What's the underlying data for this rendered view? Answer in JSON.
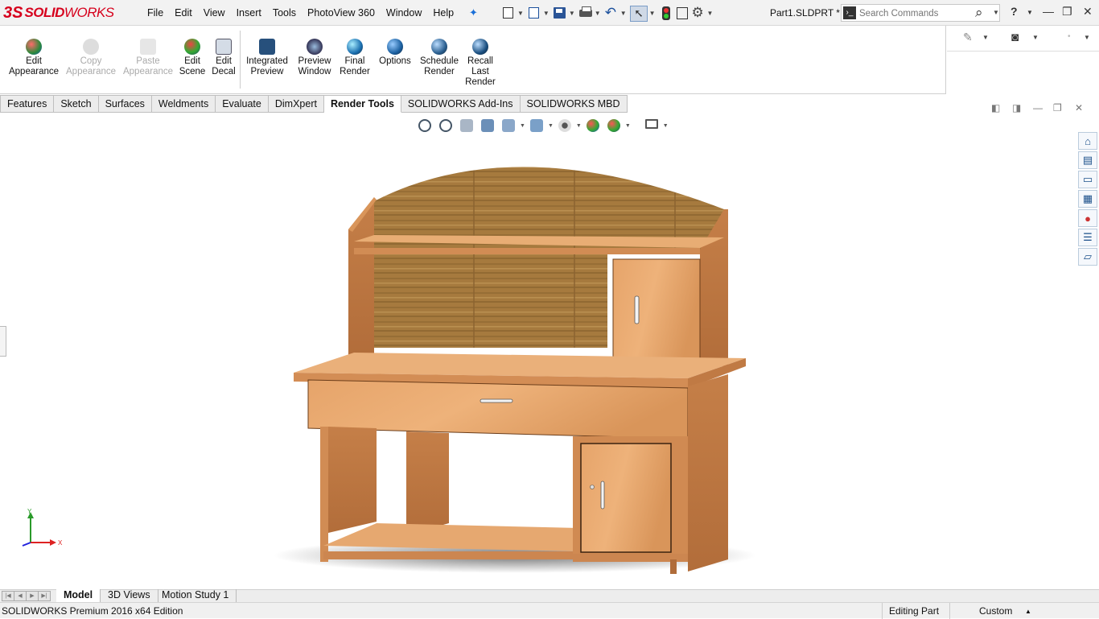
{
  "app": {
    "logo_mark": "3S",
    "logo_word_bold": "SOLID",
    "logo_word_rest": "WORKS",
    "filename": "Part1.SLDPRT *"
  },
  "menu": [
    "File",
    "Edit",
    "View",
    "Insert",
    "Tools",
    "PhotoView 360",
    "Window",
    "Help"
  ],
  "search": {
    "placeholder": "Search Commands"
  },
  "help": {
    "label": "?"
  },
  "commands": [
    {
      "label": "Edit\nAppearance",
      "enabled": true
    },
    {
      "label": "Copy\nAppearance",
      "enabled": false
    },
    {
      "label": "Paste\nAppearance",
      "enabled": false
    },
    {
      "label": "Edit\nScene",
      "enabled": true
    },
    {
      "label": "Edit\nDecal",
      "enabled": true
    },
    {
      "label": "Integrated\nPreview",
      "enabled": true
    },
    {
      "label": "Preview\nWindow",
      "enabled": true
    },
    {
      "label": "Final\nRender",
      "enabled": true
    },
    {
      "label": "Options",
      "enabled": true
    },
    {
      "label": "Schedule\nRender",
      "enabled": true
    },
    {
      "label": "Recall\nLast\nRender",
      "enabled": true
    }
  ],
  "tabs": [
    "Features",
    "Sketch",
    "Surfaces",
    "Weldments",
    "Evaluate",
    "DimXpert",
    "Render Tools",
    "SOLIDWORKS Add-Ins",
    "SOLIDWORKS MBD"
  ],
  "active_tab": "Render Tools",
  "triad": {
    "y": "Y",
    "x": "X"
  },
  "bottom_tabs": [
    "Model",
    "3D Views",
    "Motion Study 1"
  ],
  "active_bottom_tab": "Model",
  "status": {
    "edition": "SOLIDWORKS Premium 2016 x64 Edition",
    "mode": "Editing Part",
    "units": "Custom"
  },
  "colors": {
    "brand": "#d6001c",
    "wood_light": "#e8a46c",
    "wood_dark": "#c47a44",
    "wood_panel": "#a57a3c"
  }
}
